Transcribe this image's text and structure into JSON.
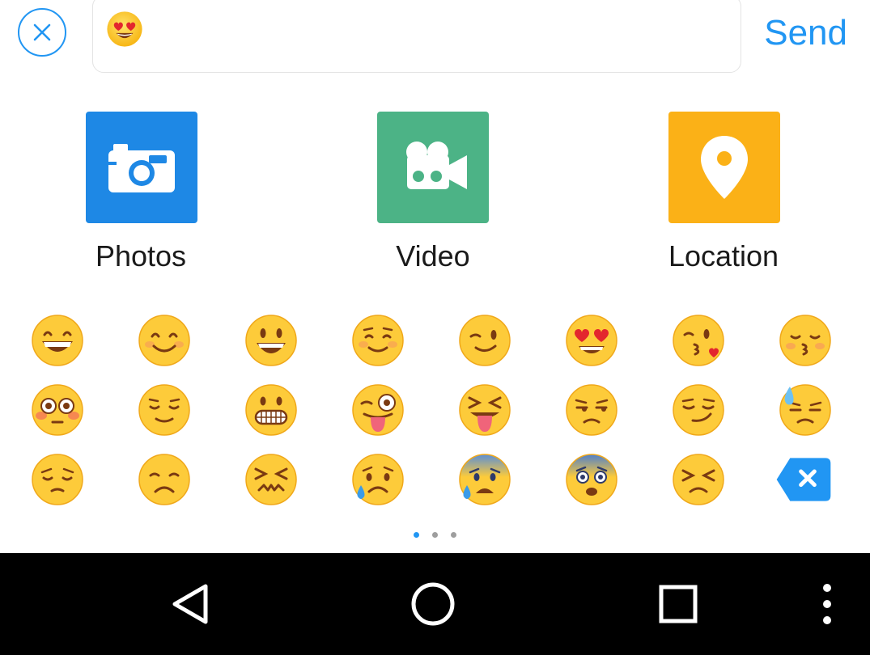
{
  "compose": {
    "input_emoji": "heart-eyes",
    "send_label": "Send"
  },
  "attachments": [
    {
      "label": "Photos",
      "icon": "camera-icon",
      "color": "#1E88E5"
    },
    {
      "label": "Video",
      "icon": "video-camera-icon",
      "color": "#4CB386"
    },
    {
      "label": "Location",
      "icon": "location-pin-icon",
      "color": "#FBB117"
    }
  ],
  "emoji_rows": [
    [
      "grinning",
      "smiling-blush",
      "smiley",
      "relaxed",
      "winking",
      "heart-eyes",
      "kissing-heart",
      "kissing-closed-eyes"
    ],
    [
      "flushed",
      "relieved",
      "grimacing",
      "stuck-out-tongue-winking",
      "stuck-out-tongue-closed-eyes",
      "unamused",
      "smirk",
      "sweat"
    ],
    [
      "pensive",
      "disappointed",
      "confounded",
      "disappointed-relieved",
      "cold-sweat",
      "fearful",
      "persevere",
      "delete-key"
    ]
  ],
  "pager": {
    "pages": 3,
    "active": 1
  },
  "nav": [
    "back-icon",
    "home-icon",
    "recents-icon",
    "menu-icon"
  ],
  "colors": {
    "accent": "#2196F3",
    "emoji_yellow": "#FDCB3A"
  }
}
